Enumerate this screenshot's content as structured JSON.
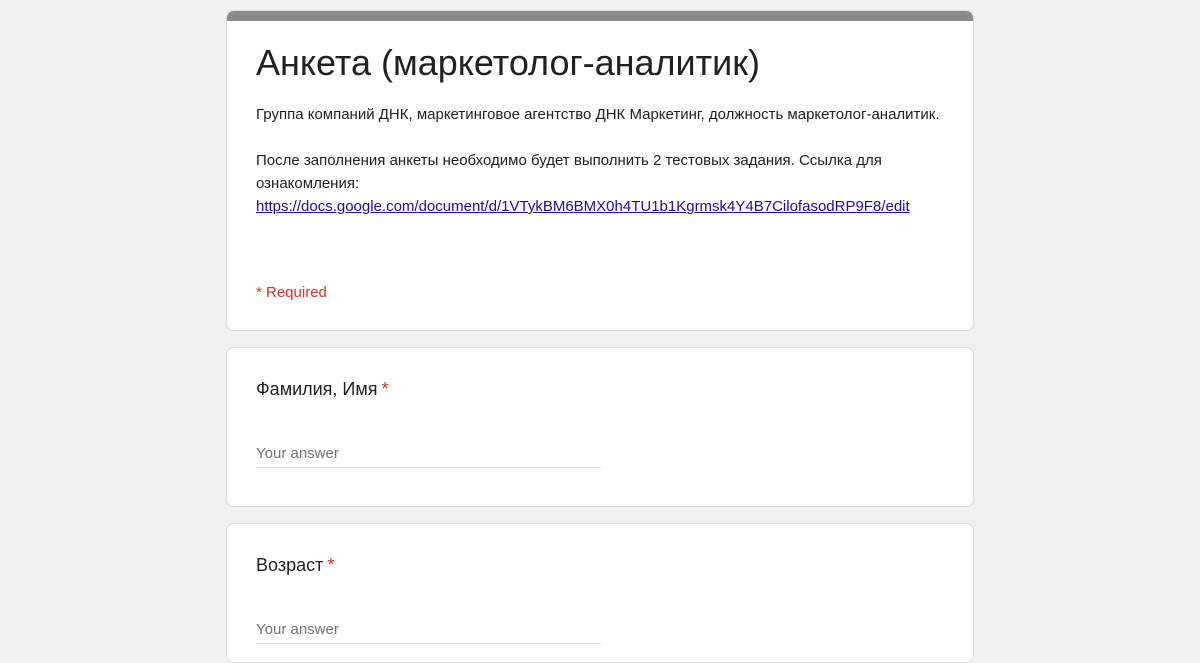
{
  "form": {
    "title": "Анкета (маркетолог-аналитик)",
    "description_line1": "Группа компаний ДНК, маркетинговое агентство ДНК Маркетинг, должность маркетолог-аналитик.",
    "description_line2": "После заполнения анкеты необходимо будет выполнить 2 тестовых задания. Ссылка для ознакомления:",
    "link_text": "https://docs.google.com/document/d/1VTykBM6BMX0h4TU1b1Kgrmsk4Y4B7CilofasodRP9F8/edit",
    "required_note": "* Required",
    "accent_color": "#8a8a8a",
    "required_color": "#d93025"
  },
  "questions": [
    {
      "title": "Фамилия, Имя",
      "required_mark": "*",
      "placeholder": "Your answer"
    },
    {
      "title": "Возраст",
      "required_mark": "*",
      "placeholder": "Your answer"
    }
  ]
}
